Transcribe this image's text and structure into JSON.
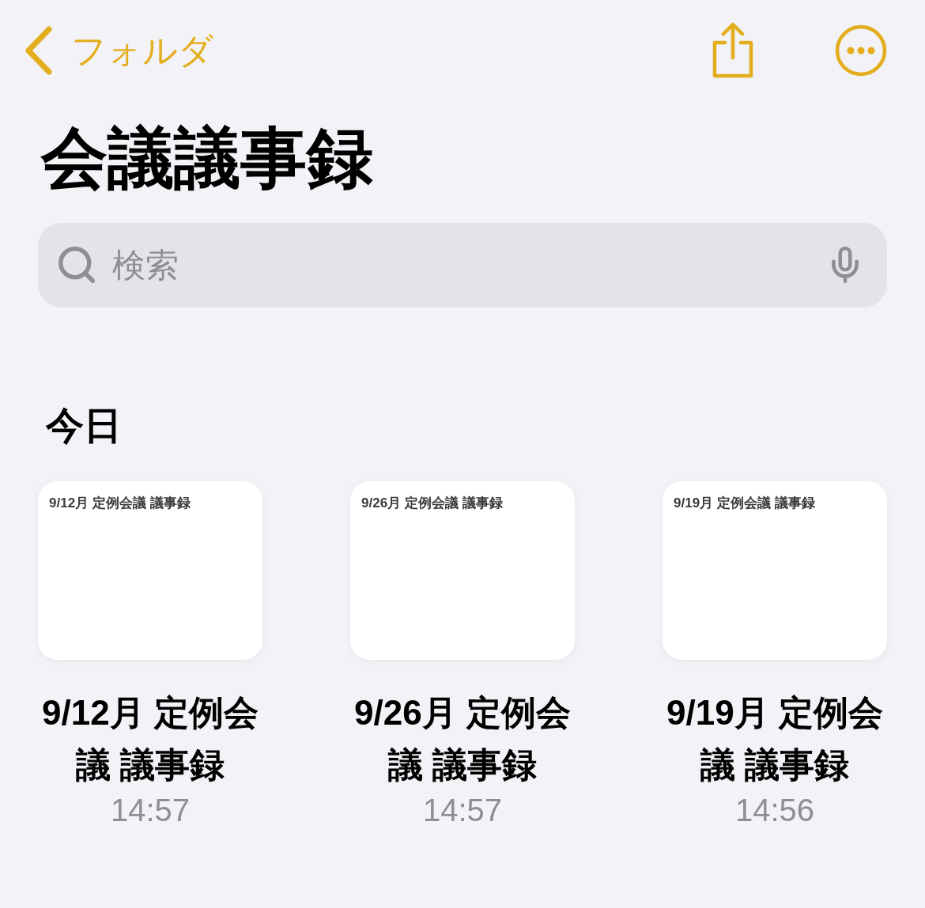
{
  "nav": {
    "back_label": "フォルダ"
  },
  "title": "会議議事録",
  "search": {
    "placeholder": "検索"
  },
  "section": {
    "title": "今日",
    "notes": [
      {
        "preview": "9/12月 定例会議 議事録",
        "title": "9/12月 定例会議 議事録",
        "time": "14:57"
      },
      {
        "preview": "9/26月 定例会議 議事録",
        "title": "9/26月 定例会議 議事録",
        "time": "14:57"
      },
      {
        "preview": "9/19月 定例会議 議事録",
        "title": "9/19月 定例会議 議事録",
        "time": "14:56"
      }
    ]
  }
}
